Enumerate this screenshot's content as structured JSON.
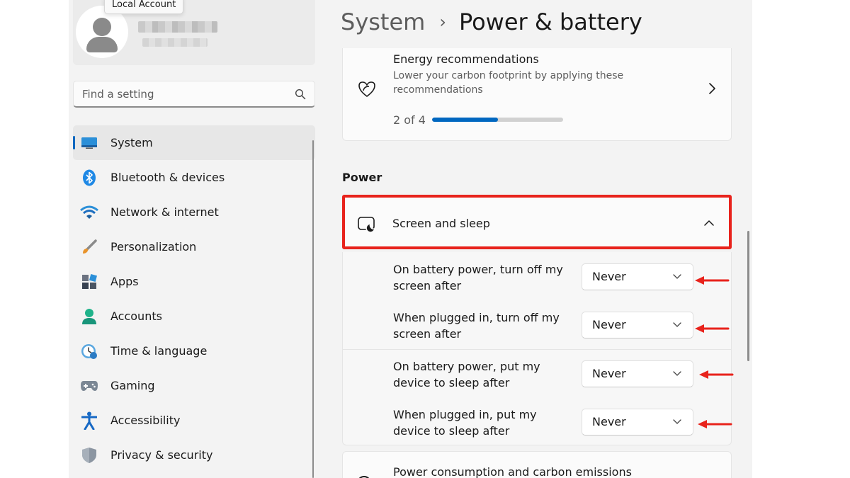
{
  "profile": {
    "tooltip": "Local Account"
  },
  "search": {
    "placeholder": "Find a setting"
  },
  "sidebar": {
    "items": [
      {
        "label": "System",
        "icon": "system-icon",
        "active": true
      },
      {
        "label": "Bluetooth & devices",
        "icon": "bluetooth-icon"
      },
      {
        "label": "Network & internet",
        "icon": "wifi-icon"
      },
      {
        "label": "Personalization",
        "icon": "brush-icon"
      },
      {
        "label": "Apps",
        "icon": "apps-icon"
      },
      {
        "label": "Accounts",
        "icon": "accounts-icon"
      },
      {
        "label": "Time & language",
        "icon": "clock-globe-icon"
      },
      {
        "label": "Gaming",
        "icon": "gamepad-icon"
      },
      {
        "label": "Accessibility",
        "icon": "accessibility-icon"
      },
      {
        "label": "Privacy & security",
        "icon": "shield-icon"
      }
    ]
  },
  "breadcrumb": {
    "parent": "System",
    "separator": "›",
    "current": "Power & battery"
  },
  "energy": {
    "title": "Energy recommendations",
    "subtitle": "Lower your carbon footprint by applying these recommendations",
    "progress_text": "2 of 4",
    "progress_fraction": 0.5
  },
  "power": {
    "section_label": "Power",
    "screen_sleep_label": "Screen and sleep",
    "rows": [
      {
        "label": "On battery power, turn off my screen after",
        "value": "Never"
      },
      {
        "label": "When plugged in, turn off my screen after",
        "value": "Never"
      },
      {
        "label": "On battery power, put my device to sleep after",
        "value": "Never"
      },
      {
        "label": "When plugged in, put my device to sleep after",
        "value": "Never"
      }
    ],
    "next_card_label": "Power consumption and carbon emissions"
  },
  "colors": {
    "accent": "#0067c0",
    "annotation_red": "#e8231c"
  }
}
